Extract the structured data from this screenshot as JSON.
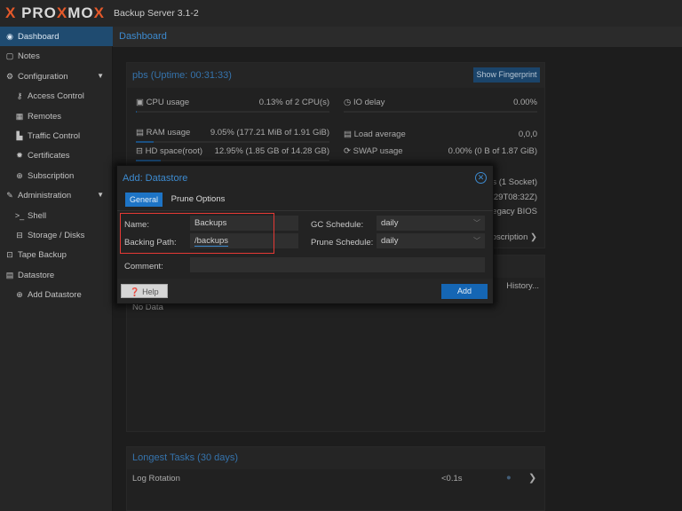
{
  "header": {
    "logo": "PROXMOX",
    "product": "Backup Server 3.1-2"
  },
  "sidebar": {
    "items": [
      {
        "label": "Dashboard",
        "icon": "dashboard-icon",
        "selected": true
      },
      {
        "label": "Notes",
        "icon": "notes-icon"
      },
      {
        "label": "Configuration",
        "icon": "gears-icon",
        "expanded": true
      },
      {
        "label": "Access Control",
        "icon": "key-icon",
        "sub": true
      },
      {
        "label": "Remotes",
        "icon": "server-icon",
        "sub": true
      },
      {
        "label": "Traffic Control",
        "icon": "chart-icon",
        "sub": true
      },
      {
        "label": "Certificates",
        "icon": "certificate-icon",
        "sub": true
      },
      {
        "label": "Subscription",
        "icon": "support-icon",
        "sub": true
      },
      {
        "label": "Administration",
        "icon": "wrench-icon",
        "expanded": true
      },
      {
        "label": "Shell",
        "icon": "terminal-icon",
        "sub": true
      },
      {
        "label": "Storage / Disks",
        "icon": "hdd-icon",
        "sub": true
      },
      {
        "label": "Tape Backup",
        "icon": "tape-icon"
      },
      {
        "label": "Datastore",
        "icon": "database-icon"
      },
      {
        "label": "Add Datastore",
        "icon": "plus-circle-icon",
        "sub": true
      }
    ]
  },
  "main": {
    "title": "Dashboard",
    "status": {
      "title": "pbs (Uptime: 00:31:33)",
      "fingerprint_button": "Show Fingerprint",
      "cpu": {
        "label": "CPU usage",
        "value": "0.13% of 2 CPU(s)",
        "percent": 0.13
      },
      "io": {
        "label": "IO delay",
        "value": "0.00%",
        "percent": 0
      },
      "ram": {
        "label": "RAM usage",
        "value": "9.05% (177.21 MiB of 1.91 GiB)",
        "percent": 9.05
      },
      "load": {
        "label": "Load average",
        "value": "0,0,0"
      },
      "hd": {
        "label": "HD space(root)",
        "value": "12.95% (1.85 GB of 14.28 GB)",
        "percent": 12.95
      },
      "swap": {
        "label": "SWAP usage",
        "value": "0.00% (0 B of 1.87 GiB)",
        "percent": 0
      },
      "partial": [
        "cs (1 Socket)",
        "-29T08:32Z)",
        "Legacy BIOS",
        "ubscription"
      ]
    },
    "datastore_panel": {
      "history": "History...",
      "empty": "No Data"
    },
    "tasks": {
      "title": "Longest Tasks (30 days)",
      "rows": [
        {
          "name": "Log Rotation",
          "duration": "<0.1s",
          "status": "ok"
        }
      ]
    }
  },
  "dialog": {
    "title": "Add: Datastore",
    "tabs": [
      "General",
      "Prune Options"
    ],
    "name_label": "Name:",
    "name_value": "Backups",
    "path_label": "Backing Path:",
    "path_value": "/backups",
    "gc_label": "GC Schedule:",
    "gc_value": "daily",
    "prune_label": "Prune Schedule:",
    "prune_value": "daily",
    "comment_label": "Comment:",
    "comment_value": "",
    "help": "Help",
    "add": "Add",
    "highlight_color": "#e53935"
  }
}
